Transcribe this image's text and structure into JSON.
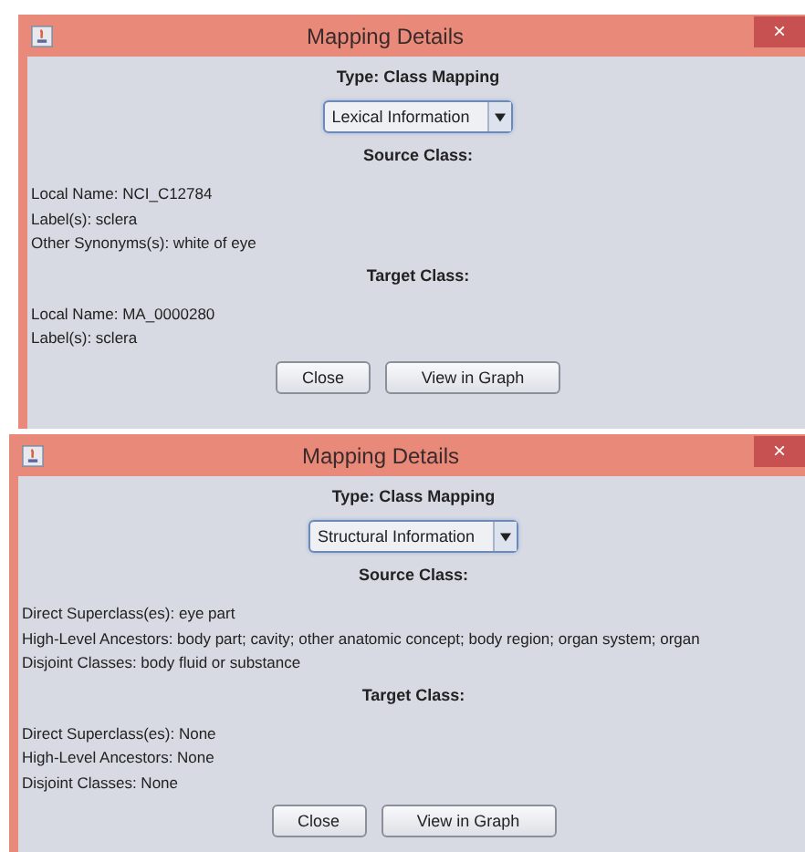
{
  "windows": [
    {
      "title": "Mapping Details",
      "close_glyph": "×",
      "type": "Type: Class Mapping",
      "dropdown": {
        "value": "Lexical Information"
      },
      "sections": [
        {
          "heading": "Source Class:",
          "lines": [
            "Local Name: NCI_C12784",
            "Label(s): sclera",
            "Other Synonyms(s): white of eye"
          ]
        },
        {
          "heading": "Target Class:",
          "lines": [
            "Local Name: MA_0000280",
            "Label(s): sclera"
          ]
        }
      ],
      "buttons": [
        "Close",
        "View in Graph"
      ]
    },
    {
      "title": "Mapping Details",
      "close_glyph": "×",
      "type": "Type: Class Mapping",
      "dropdown": {
        "value": "Structural Information"
      },
      "sections": [
        {
          "heading": "Source Class:",
          "lines": [
            "Direct Superclass(es): eye part",
            "High-Level Ancestors: body part; cavity; other anatomic concept; body region; organ system; organ",
            "Disjoint Classes: body fluid or substance"
          ]
        },
        {
          "heading": "Target Class:",
          "lines": [
            "Direct Superclass(es): None",
            "High-Level Ancestors: None",
            "Disjoint Classes: None"
          ]
        }
      ],
      "buttons": [
        "Close",
        "View in Graph"
      ]
    }
  ]
}
